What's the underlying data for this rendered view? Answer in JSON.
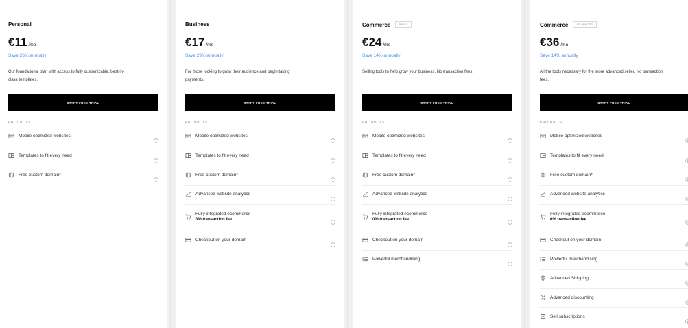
{
  "plans": [
    {
      "name": "Personal",
      "badge": "",
      "price": "€11",
      "per": "/mo",
      "save": "Save 26% annually",
      "desc_lines": [
        "Our foundational plan with access to fully customizable, best-in-",
        "class templates."
      ],
      "button": "START FREE TRIAL",
      "products_label": "PRODUCTS",
      "features": [
        {
          "icon": "website-icon",
          "label": "Mobile optimized websites",
          "sub": ""
        },
        {
          "icon": "template-icon",
          "label": "Templates to fit every need",
          "sub": ""
        },
        {
          "icon": "globe-icon",
          "label": "Free custom domain*",
          "sub": ""
        }
      ]
    },
    {
      "name": "Business",
      "badge": "",
      "price": "€17",
      "per": "/mo",
      "save": "Save 29% annually",
      "desc_lines": [
        "For those looking to grow their audience and begin taking",
        "payments."
      ],
      "button": "START FREE TRIAL",
      "products_label": "PRODUCTS",
      "features": [
        {
          "icon": "website-icon",
          "label": "Mobile optimized websites",
          "sub": ""
        },
        {
          "icon": "template-icon",
          "label": "Templates to fit every need",
          "sub": ""
        },
        {
          "icon": "globe-icon",
          "label": "Free custom domain*",
          "sub": ""
        },
        {
          "icon": "analytics-icon",
          "label": "Advanced website analytics",
          "sub": ""
        },
        {
          "icon": "cart-icon",
          "label": "Fully integrated ecommerce",
          "sub": "3% transaction fee"
        },
        {
          "icon": "card-icon",
          "label": "Checkout on your domain",
          "sub": ""
        }
      ]
    },
    {
      "name": "Commerce",
      "badge": "BASIC",
      "price": "€24",
      "per": "/mo",
      "save": "Save 14% annually",
      "desc_lines": [
        "Selling tools to help grow your business. No transaction fees."
      ],
      "button": "START FREE TRIAL",
      "products_label": "PRODUCTS",
      "features": [
        {
          "icon": "website-icon",
          "label": "Mobile optimized websites",
          "sub": ""
        },
        {
          "icon": "template-icon",
          "label": "Templates to fit every need",
          "sub": ""
        },
        {
          "icon": "globe-icon",
          "label": "Free custom domain*",
          "sub": ""
        },
        {
          "icon": "analytics-icon",
          "label": "Advanced website analytics",
          "sub": ""
        },
        {
          "icon": "cart-icon",
          "label": "Fully integrated ecommerce",
          "sub": "0% transaction fee"
        },
        {
          "icon": "card-icon",
          "label": "Checkout on your domain",
          "sub": ""
        },
        {
          "icon": "list-icon",
          "label": "Powerful merchandising",
          "sub": ""
        }
      ]
    },
    {
      "name": "Commerce",
      "badge": "ADVANCED",
      "price": "€36",
      "per": "/mo",
      "save": "Save 14% annually",
      "desc_lines": [
        "All the tools necessary for the more advanced seller. No transaction",
        "fees."
      ],
      "button": "START FREE TRIAL",
      "products_label": "PRODUCTS",
      "features": [
        {
          "icon": "website-icon",
          "label": "Mobile optimized websites",
          "sub": ""
        },
        {
          "icon": "template-icon",
          "label": "Templates to fit every need",
          "sub": ""
        },
        {
          "icon": "globe-icon",
          "label": "Free custom domain*",
          "sub": ""
        },
        {
          "icon": "analytics-icon",
          "label": "Advanced website analytics",
          "sub": ""
        },
        {
          "icon": "cart-icon",
          "label": "Fully integrated ecommerce",
          "sub": "0% transaction fee"
        },
        {
          "icon": "card-icon",
          "label": "Checkout on your domain",
          "sub": ""
        },
        {
          "icon": "list-icon",
          "label": "Powerful merchandising",
          "sub": ""
        },
        {
          "icon": "location-pin-icon",
          "label": "Advanced Shipping",
          "sub": ""
        },
        {
          "icon": "percent-icon",
          "label": "Advanced discounting",
          "sub": ""
        },
        {
          "icon": "subscription-icon",
          "label": "Sell subscriptions",
          "sub": ""
        }
      ]
    }
  ],
  "colors": {
    "accent_link": "#4d90e0",
    "button_bg": "#000000",
    "button_text": "#ffffff"
  }
}
